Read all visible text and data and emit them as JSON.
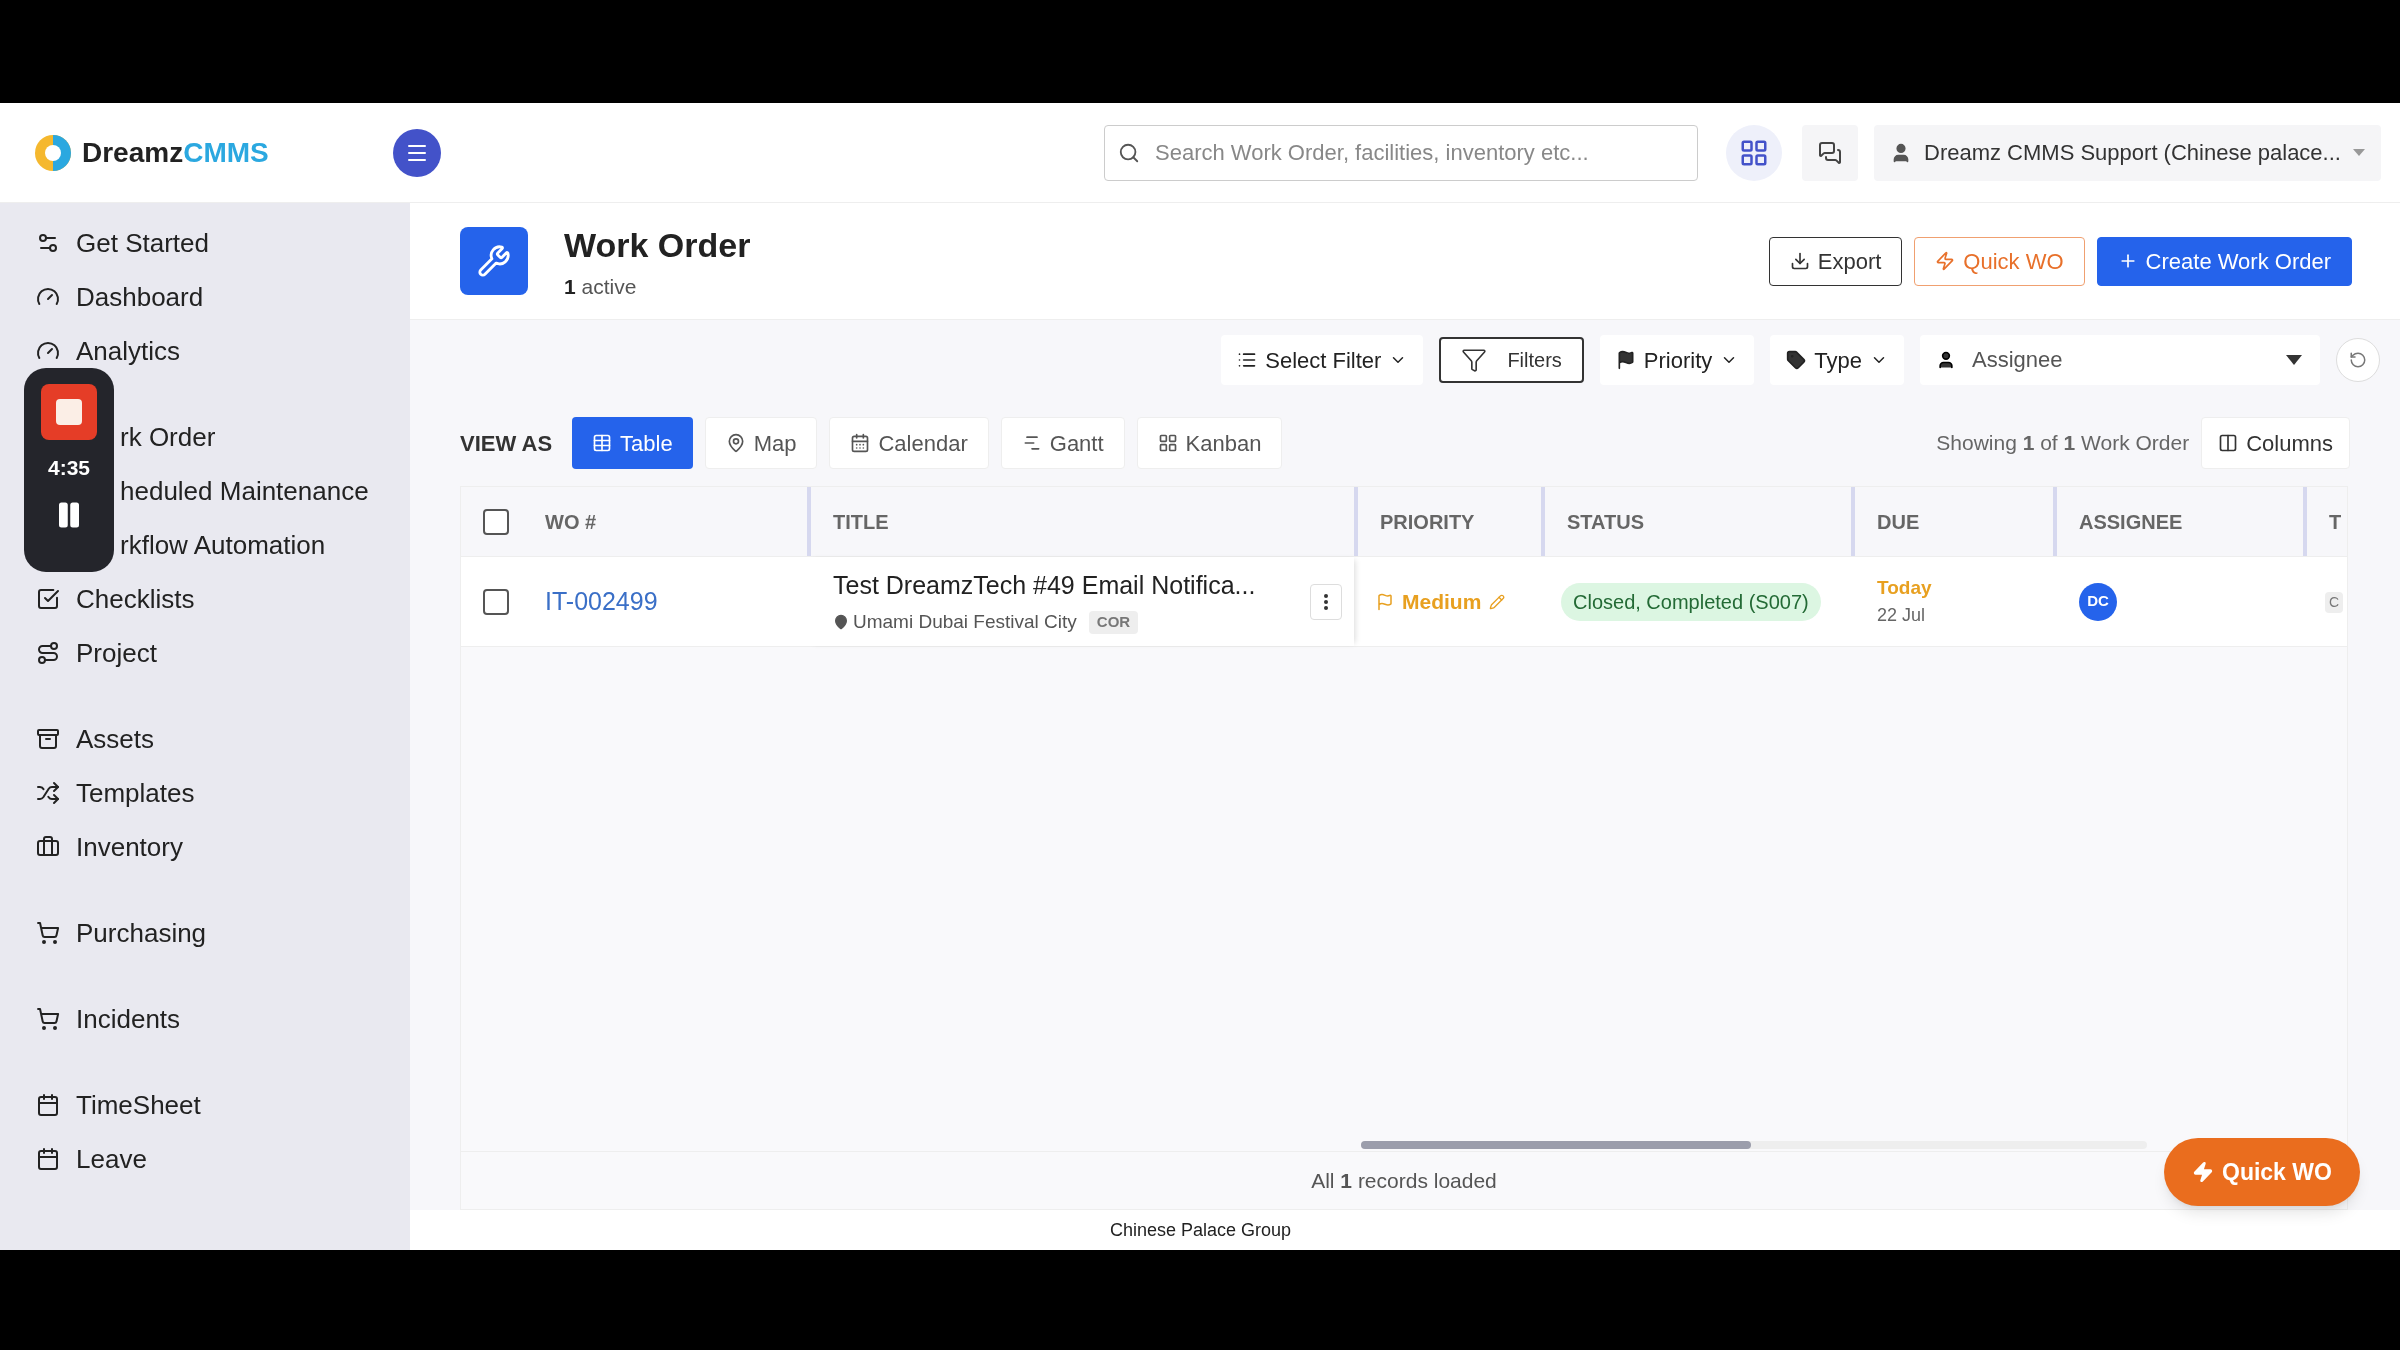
{
  "recorder": {
    "time": "4:35"
  },
  "header": {
    "logo": {
      "part_1": "Dreamz",
      "part_2": "CMMS"
    },
    "search": {
      "placeholder": "Search Work Order, facilities, inventory etc..."
    },
    "user": {
      "name": "Dreamz CMMS Support (Chinese palace..."
    }
  },
  "sidebar": {
    "sections": [
      [
        {
          "label": "Get Started",
          "covered": false
        },
        {
          "label": "Dashboard",
          "covered": false
        },
        {
          "label": "Analytics",
          "covered": false
        }
      ],
      [
        {
          "label": "rk Order",
          "covered": true
        },
        {
          "label": "heduled Maintenance",
          "covered": true
        },
        {
          "label": "rkflow Automation",
          "covered": true
        },
        {
          "label": "Checklists",
          "covered": false
        },
        {
          "label": "Project",
          "covered": false
        }
      ],
      [
        {
          "label": "Assets",
          "covered": false
        },
        {
          "label": "Templates",
          "covered": false
        },
        {
          "label": "Inventory",
          "covered": false
        }
      ],
      [
        {
          "label": "Purchasing",
          "covered": false
        }
      ],
      [
        {
          "label": "Incidents",
          "covered": false
        }
      ],
      [
        {
          "label": "TimeSheet",
          "covered": false
        },
        {
          "label": "Leave",
          "covered": false
        }
      ]
    ]
  },
  "page": {
    "title": "Work Order",
    "active_count": "1",
    "active_label": "active",
    "buttons": [
      {
        "label": "Export",
        "kind": "outline"
      },
      {
        "label": "Quick WO",
        "kind": "warning"
      },
      {
        "label": "Create Work Order",
        "kind": "primary"
      }
    ]
  },
  "filters": {
    "select_filter": "Select Filter",
    "filters": "Filters",
    "priority": "Priority",
    "type": "Type",
    "assignee": {
      "placeholder": "Assignee"
    }
  },
  "view": {
    "label": "VIEW AS",
    "options": [
      {
        "label": "Table",
        "selected": true
      },
      {
        "label": "Map",
        "selected": false
      },
      {
        "label": "Calendar",
        "selected": false
      },
      {
        "label": "Gantt",
        "selected": false
      },
      {
        "label": "Kanban",
        "selected": false
      }
    ],
    "showing": "Showing **1** of **1** Work Order",
    "columns_button": "Columns"
  },
  "table": {
    "select_all": {
      "checked": false
    },
    "columns": [
      "WO #",
      "TITLE",
      "PRIORITY",
      "STATUS",
      "DUE",
      "ASSIGNEE",
      "T"
    ],
    "rows": [
      {
        "checked": false,
        "wo": "IT-002499",
        "title": "Test DreamzTech #49 Email Notifica...",
        "location": "Umami Dubai Festival City",
        "tag": "COR",
        "priority": "Medium",
        "status": "Closed, Completed (S007)",
        "due_day": "Today",
        "due_date": "22 Jul",
        "assignee": "DC",
        "column_7": "C"
      }
    ]
  },
  "footer": {
    "records": "All **1** records loaded",
    "fab": "Quick WO",
    "company": "Chinese Palace Group"
  }
}
